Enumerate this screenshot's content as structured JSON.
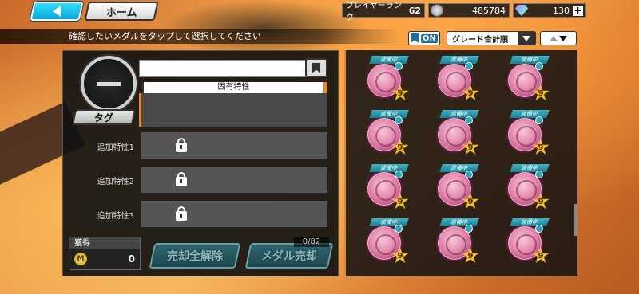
{
  "header": {
    "home_label": "ホーム",
    "rank_label": "プレイヤーランク",
    "rank_value": "62",
    "coins": "485784",
    "gems": "130",
    "plus": "+"
  },
  "instruction": "確認したいメダルをタップして選択してください",
  "toolbar": {
    "toggle_label": "ON",
    "sort_select": "グレード合計順"
  },
  "detail": {
    "trait_head": "固有特性",
    "tag_label": "タグ",
    "extra_traits": [
      "追加特性1",
      "追加特性2",
      "追加特性3"
    ]
  },
  "bottom": {
    "gain_title": "獲得",
    "gain_currency": "M",
    "gain_value": "0",
    "release_all_label": "売却全解除",
    "sell_label": "メダル売却",
    "sell_count": "0/82"
  },
  "medals": [
    {
      "tag": "装備中",
      "grade": "9"
    },
    {
      "tag": "装備中",
      "grade": "9"
    },
    {
      "tag": "装備中",
      "grade": "9"
    },
    {
      "tag": "装備中",
      "grade": "9"
    },
    {
      "tag": "装備中",
      "grade": "9"
    },
    {
      "tag": "装備中",
      "grade": "9"
    },
    {
      "tag": "装備中",
      "grade": "9"
    },
    {
      "tag": "装備中",
      "grade": "9"
    },
    {
      "tag": "装備中",
      "grade": "9"
    },
    {
      "tag": "装備中",
      "grade": "9"
    },
    {
      "tag": "装備中",
      "grade": "9"
    },
    {
      "tag": "装備中",
      "grade": "9"
    }
  ]
}
